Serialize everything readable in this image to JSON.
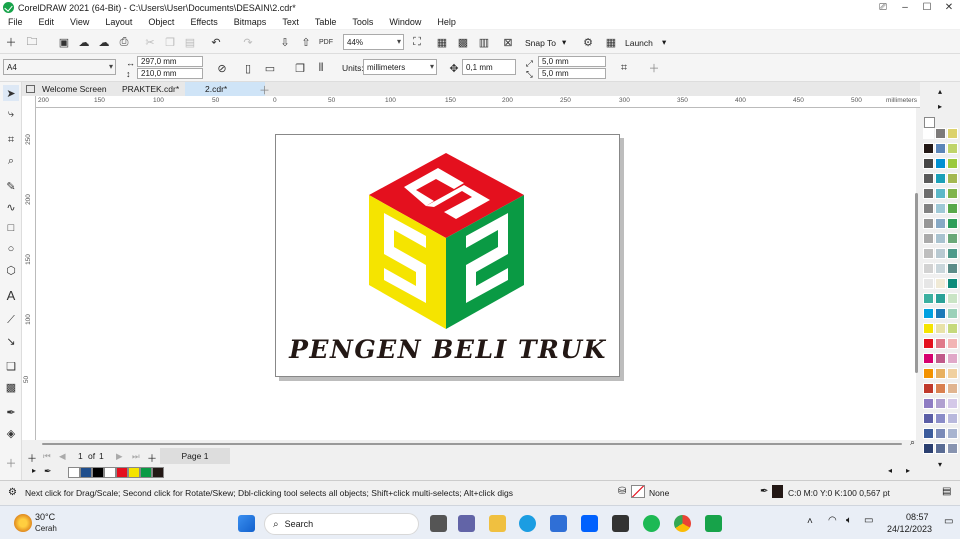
{
  "window": {
    "title": "CorelDRAW 2021 (64-Bit) - C:\\Users\\User\\Documents\\DESAIN\\2.cdr*"
  },
  "menu": [
    "File",
    "Edit",
    "View",
    "Layout",
    "Object",
    "Effects",
    "Bitmaps",
    "Text",
    "Table",
    "Tools",
    "Window",
    "Help"
  ],
  "toolbar": {
    "zoom": "44%",
    "snap_label": "Snap To",
    "launch_label": "Launch"
  },
  "property_bar": {
    "page_size": "A4",
    "width": "297,0 mm",
    "height": "210,0 mm",
    "units_label": "Units:",
    "units": "millimeters",
    "nudge": "0,1 mm",
    "dup_x": "5,0 mm",
    "dup_y": "5,0 mm"
  },
  "tabs": [
    {
      "label": "Welcome Screen"
    },
    {
      "label": "PRAKTEK.cdr*"
    },
    {
      "label": "2.cdr*",
      "active": true
    }
  ],
  "ruler": {
    "h_ticks": [
      "200",
      "150",
      "100",
      "50",
      "0",
      "50",
      "100",
      "150",
      "200",
      "250",
      "300",
      "350",
      "400",
      "450",
      "500"
    ],
    "h_unit": "millimeters",
    "v_ticks": [
      "250",
      "200",
      "150",
      "100",
      "50",
      "0"
    ],
    "v_unit": "millimeters"
  },
  "artwork": {
    "text": "PENGEN BELI TRUK",
    "colors": {
      "top": "#e4101e",
      "left": "#f5e400",
      "right": "#0a9a44",
      "text": "#231815"
    }
  },
  "page_nav": {
    "current": "1",
    "of_label": "of",
    "total": "1",
    "page_tab": "Page 1"
  },
  "status": {
    "hint": "Next click for Drag/Scale; Second click for Rotate/Skew; Dbl-clicking tool selects all objects; Shift+click multi-selects; Alt+click digs",
    "fill": "None",
    "outline": "C:0 M:0 Y:0 K:100  0,567 pt"
  },
  "taskbar": {
    "weather_temp": "30°C",
    "weather_desc": "Cerah",
    "search": "Search",
    "time": "08:57",
    "date": "24/12/2023"
  },
  "doc_palette_colors": [
    "#1f4e8c",
    "#000000",
    "#ffffff",
    "#e4101e",
    "#f5e400",
    "#0a9a44",
    "#231815"
  ],
  "palette_colors": [
    "#ffffff",
    "#7d7b7a",
    "#dcd26c",
    "#231815",
    "#5b85b8",
    "#bfd46a",
    "#464646",
    "#0090d2",
    "#9bc93d",
    "#5a5a5a",
    "#1aa0b8",
    "#a3b851",
    "#6e6e6e",
    "#5cb8c8",
    "#7fb44b",
    "#828282",
    "#9ec8d6",
    "#57a84a",
    "#969696",
    "#87a9c5",
    "#2e9e5a",
    "#aaaaaa",
    "#a8c2cf",
    "#6aa878",
    "#bebebe",
    "#b8c9d1",
    "#4f9a8a",
    "#d2d2d2",
    "#cad6db",
    "#5c8c88",
    "#e6e6e6",
    "#f0ead6",
    "#0d8b7a",
    "#3cb0a0",
    "#2aa198",
    "#c9e4c5",
    "#00a0e0",
    "#1d7ab8",
    "#9ad1b9",
    "#f5e400",
    "#e8e2a8",
    "#c5d97c",
    "#e4101e",
    "#e07a8a",
    "#f2b4b4",
    "#d6006f",
    "#c05a8a",
    "#e0a8c8",
    "#f39200",
    "#e8b060",
    "#f0d0a0",
    "#c0392b",
    "#d98050",
    "#e0b490",
    "#8e7cc3",
    "#b0a0d0",
    "#d4c8e8",
    "#5b5ea6",
    "#8a8cc8",
    "#b8b8dc",
    "#3b5b9c",
    "#7a8ab8",
    "#a8b4d0",
    "#2b3f70",
    "#5a6c94",
    "#8894b0"
  ]
}
